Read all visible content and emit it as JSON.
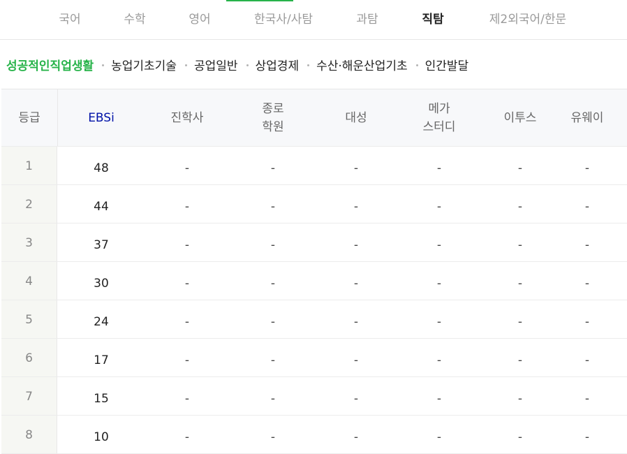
{
  "subject_tabs": [
    "국어",
    "수학",
    "영어",
    "한국사/사탐",
    "과탐",
    "직탐",
    "제2외국어/한문"
  ],
  "active_tab": "직탐",
  "sub_subjects": [
    "성공적인직업생활",
    "농업기초기술",
    "공업일반",
    "상업경제",
    "수산·해운산업기초",
    "인간발달"
  ],
  "active_sub_subject": "성공적인직업생활",
  "table": {
    "headers": [
      "등급",
      "EBSi",
      "진학사",
      "종로\n학원",
      "대성",
      "메가\n스터디",
      "이투스",
      "유웨이"
    ],
    "rows": [
      [
        "1",
        "48",
        "-",
        "-",
        "-",
        "-",
        "-",
        "-"
      ],
      [
        "2",
        "44",
        "-",
        "-",
        "-",
        "-",
        "-",
        "-"
      ],
      [
        "3",
        "37",
        "-",
        "-",
        "-",
        "-",
        "-",
        "-"
      ],
      [
        "4",
        "30",
        "-",
        "-",
        "-",
        "-",
        "-",
        "-"
      ],
      [
        "5",
        "24",
        "-",
        "-",
        "-",
        "-",
        "-",
        "-"
      ],
      [
        "6",
        "17",
        "-",
        "-",
        "-",
        "-",
        "-",
        "-"
      ],
      [
        "7",
        "15",
        "-",
        "-",
        "-",
        "-",
        "-",
        "-"
      ],
      [
        "8",
        "10",
        "-",
        "-",
        "-",
        "-",
        "-",
        "-"
      ]
    ]
  },
  "colors": {
    "accent_green": "#27b34a",
    "ebsi_blue": "#0012a8"
  }
}
